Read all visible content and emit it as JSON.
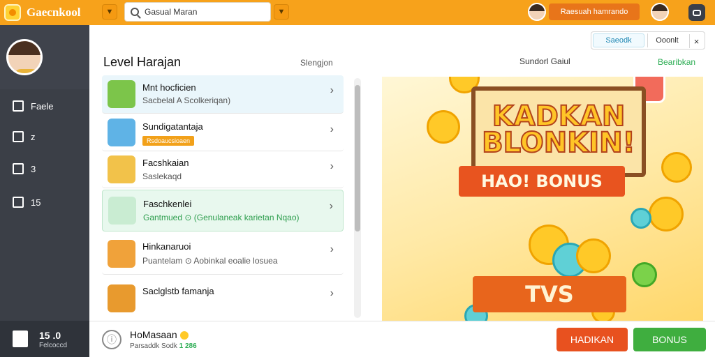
{
  "app": {
    "title": "Gaecnkool"
  },
  "search": {
    "value": "Gasual Maran"
  },
  "header": {
    "user_label": "Raesuah hamrando"
  },
  "sidebar": {
    "items": [
      {
        "label": "Faele"
      },
      {
        "label": "z"
      },
      {
        "label": "3"
      },
      {
        "label": "15"
      }
    ],
    "footer": {
      "title": "15 .0",
      "subtitle": "Felcoccd"
    }
  },
  "panel": {
    "title": "Level Harajan",
    "action": "Slengjon",
    "items": [
      {
        "title": "Mnt hocficien",
        "subtitle": "Sacbelal A Scolkeriqan)"
      },
      {
        "title": "Sundigatantaja",
        "tag": "Rsdoaucsioaen"
      },
      {
        "title": "Facshkaian",
        "subtitle": "Saslekaqd"
      },
      {
        "title": "Faschkenlei",
        "subtitle": "Gantmued ⊙ (Genulaneak karietan Nqao)"
      },
      {
        "title": "Hinkanaruoi",
        "subtitle": "Puantelam ⊙ Aobinkal eoalie losuea"
      },
      {
        "title": "Saclglstb famanja"
      }
    ]
  },
  "promo": {
    "label": "Sundorl Gaiul",
    "link": "Bearibkan",
    "segment": {
      "option_a": "Saeodk",
      "option_b": "Ooonlt",
      "close": "×"
    },
    "banner_title": "KADKAN BLONKIN!",
    "ribbon_text": "HAO! BONUS",
    "ribbon2_text": "TVS"
  },
  "bottom": {
    "title": "HoMasaan",
    "subtitle_text": "Parsaddk Sodk",
    "subtitle_value": "1 286",
    "info_icon": "ⓘ",
    "btn_primary": "HADIKAN",
    "btn_secondary": "BONUS"
  },
  "icons": {
    "dropdown": "chevron-down-icon",
    "chevron": "chevron-right-icon"
  },
  "colors": {
    "topbar": "#f7a21b",
    "sidebar": "#3b3f47",
    "accent_red": "#e8511f",
    "accent_green": "#3fae3f"
  }
}
